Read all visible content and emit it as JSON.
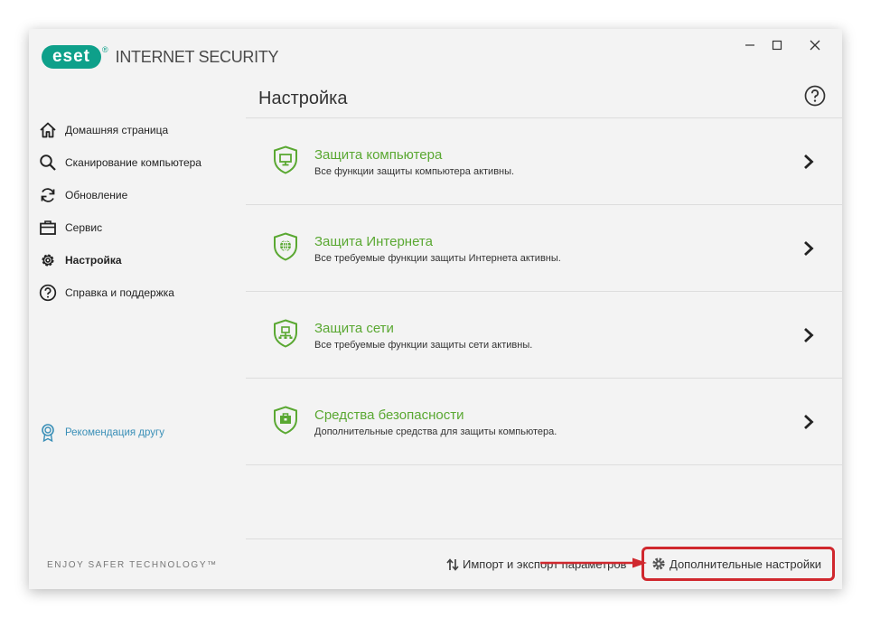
{
  "app": {
    "brand": "eset",
    "product": "INTERNET SECURITY",
    "reg_mark": "®"
  },
  "colors": {
    "brand_teal": "#0ea08a",
    "accent_green": "#5aa832",
    "link_blue": "#3a8fb7",
    "highlight_red": "#d0282e"
  },
  "window_controls": [
    "minimize-icon",
    "maximize-icon",
    "close-icon"
  ],
  "sidebar": {
    "items": [
      {
        "label": "Домашняя страница",
        "icon": "home-icon"
      },
      {
        "label": "Сканирование компьютера",
        "icon": "search-icon"
      },
      {
        "label": "Обновление",
        "icon": "refresh-icon"
      },
      {
        "label": "Сервис",
        "icon": "toolbox-icon"
      },
      {
        "label": "Настройка",
        "icon": "gear-icon",
        "active": true
      },
      {
        "label": "Справка и поддержка",
        "icon": "question-icon"
      }
    ],
    "recommend": "Рекомендация другу",
    "tagline": "ENJOY SAFER TECHNOLOGY™"
  },
  "main": {
    "title": "Настройка",
    "rows": [
      {
        "title": "Защита компьютера",
        "subtitle": "Все функции защиты компьютера активны.",
        "icon": "monitor-shield-icon"
      },
      {
        "title": "Защита Интернета",
        "subtitle": "Все требуемые функции защиты Интернета активны.",
        "icon": "globe-shield-icon"
      },
      {
        "title": "Защита сети",
        "subtitle": "Все требуемые функции защиты сети активны.",
        "icon": "network-shield-icon"
      },
      {
        "title": "Средства безопасности",
        "subtitle": "Дополнительные средства для защиты компьютера.",
        "icon": "briefcase-shield-icon"
      }
    ]
  },
  "footer": {
    "import_export": "Импорт и экспорт параметров",
    "advanced": "Дополнительные настройки"
  }
}
